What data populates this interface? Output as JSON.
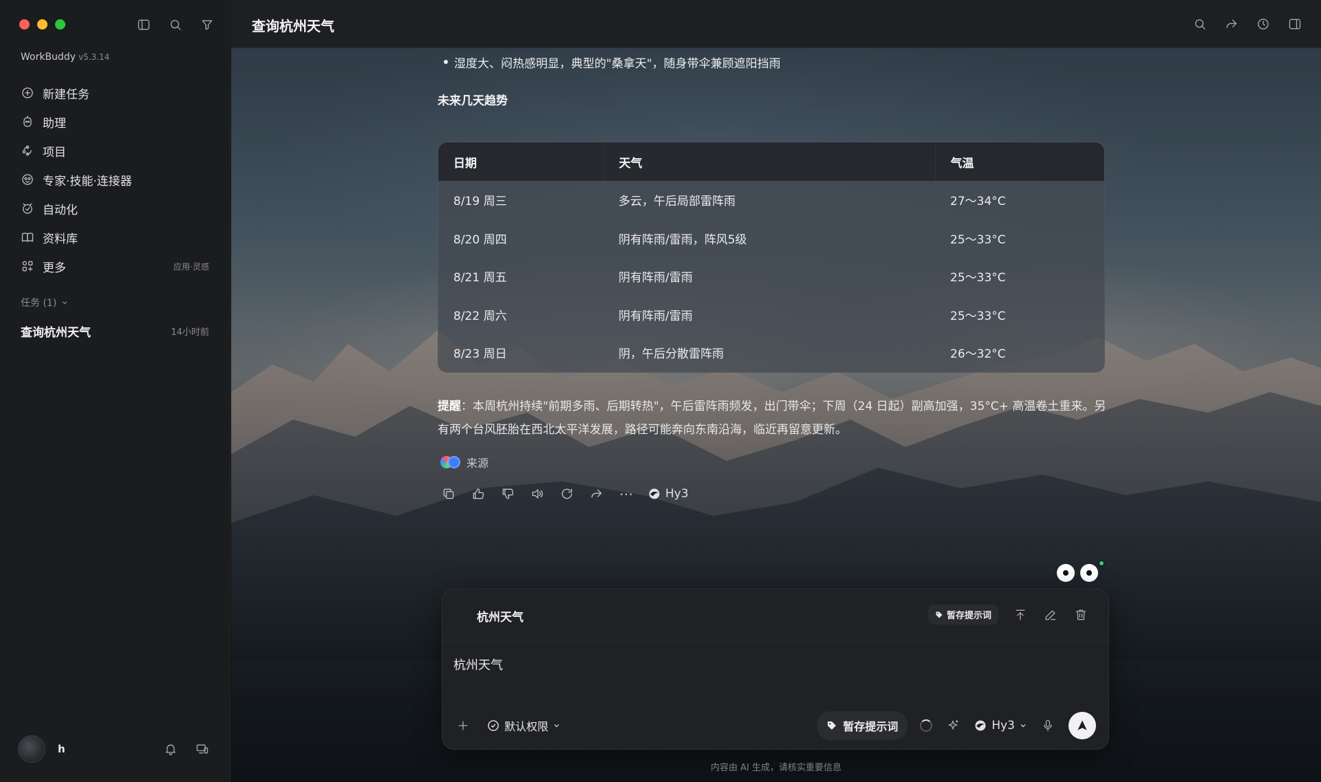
{
  "app": {
    "name": "WorkBuddy",
    "version": "v5.3.14"
  },
  "sidebar": {
    "nav": [
      {
        "label": "新建任务",
        "icon": "plus-circle-icon"
      },
      {
        "label": "助理",
        "icon": "assistant-icon"
      },
      {
        "label": "项目",
        "icon": "project-icon"
      },
      {
        "label": "专家·技能·连接器",
        "icon": "expert-icon"
      },
      {
        "label": "自动化",
        "icon": "automation-icon"
      },
      {
        "label": "资料库",
        "icon": "library-icon"
      },
      {
        "label": "更多",
        "icon": "more-grid-icon",
        "meta": "应用·灵感"
      }
    ],
    "tasks_header": "任务 (1)",
    "task": {
      "title": "查询杭州天气",
      "time": "14小时前"
    },
    "user": {
      "name": "h"
    }
  },
  "header": {
    "title": "查询杭州天气"
  },
  "message": {
    "bullet": "湿度大、闷热感明显，典型的\"桑拿天\"，随身带伞兼顾遮阳挡雨",
    "subhead": "未来几天趋势",
    "table": {
      "headers": [
        "日期",
        "天气",
        "气温"
      ],
      "rows": [
        [
          "8/19 周三",
          "多云，午后局部雷阵雨",
          "27～34°C"
        ],
        [
          "8/20 周四",
          "阴有阵雨/雷雨，阵风5级",
          "25～33°C"
        ],
        [
          "8/21 周五",
          "阴有阵雨/雷雨",
          "25～33°C"
        ],
        [
          "8/22 周六",
          "阴有阵雨/雷雨",
          "25～33°C"
        ],
        [
          "8/23 周日",
          "阴，午后分散雷阵雨",
          "26～32°C"
        ]
      ]
    },
    "notice_label": "提醒",
    "notice_text": "：本周杭州持续\"前期多雨、后期转热\"，午后雷阵雨频发，出门带伞；下周（24 日起）副高加强，35°C+ 高温卷土重来。另有两个台风胚胎在西北太平洋发展，路径可能奔向东南沿海，临近再留意更新。",
    "source_label": "来源",
    "model": "Hy3"
  },
  "composer": {
    "title": "杭州天气",
    "save_prompt_small": "暂存提示词",
    "text": "杭州天气",
    "permission": "默认权限",
    "save_prompt": "暂存提示词",
    "model": "Hy3"
  },
  "footer": "内容由 AI 生成，请核实重要信息",
  "colors": {
    "accent_green": "#32d074",
    "traffic_red": "#ff5f57",
    "traffic_yellow": "#febc2e",
    "traffic_green": "#28c840"
  }
}
